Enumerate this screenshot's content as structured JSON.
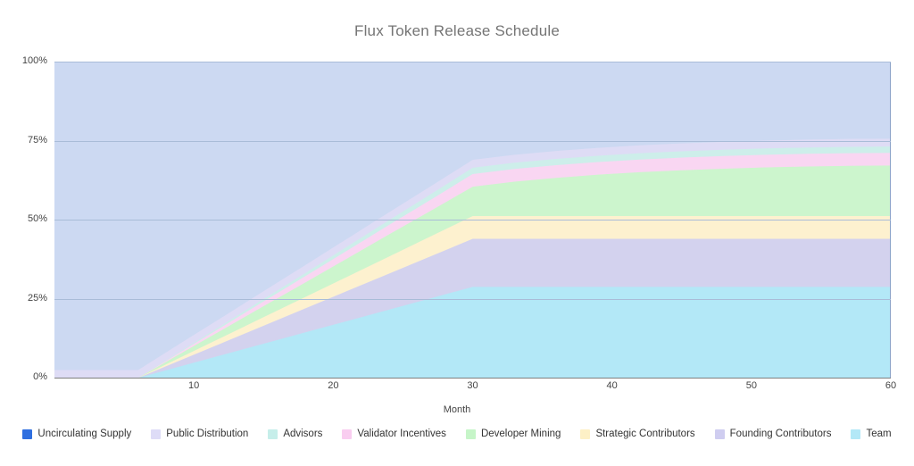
{
  "chart_data": {
    "type": "area",
    "title": "Flux Token Release Schedule",
    "xlabel": "Month",
    "ylabel": "",
    "stacked": true,
    "normalized_percent": true,
    "grid": true,
    "legend_position": "bottom",
    "xlim": [
      0,
      60
    ],
    "ylim": [
      0,
      100
    ],
    "xticks": [
      10,
      20,
      30,
      40,
      50,
      60
    ],
    "xtick_labels": [
      "10",
      "20",
      "30",
      "40",
      "50",
      "60"
    ],
    "yticks": [
      0,
      25,
      50,
      75,
      100
    ],
    "ytick_labels": [
      "0%",
      "25%",
      "50%",
      "75%",
      "100%"
    ],
    "x": [
      0,
      3,
      6,
      9,
      12,
      15,
      18,
      21,
      24,
      27,
      30,
      33,
      36,
      39,
      42,
      45,
      48,
      51,
      54,
      57,
      60
    ],
    "series": [
      {
        "name": "Team",
        "color": "#b3e8f7",
        "legend_color": "#b3e8f7",
        "values": [
          0,
          0,
          0,
          3.6,
          7.2,
          10.8,
          14.4,
          18.0,
          21.6,
          25.2,
          28.8,
          28.8,
          28.8,
          28.8,
          28.8,
          28.8,
          28.8,
          28.8,
          28.8,
          28.8,
          28.8
        ]
      },
      {
        "name": "Founding Contributors",
        "color": "#d3d2ee",
        "legend_color": "#cfcdf0",
        "values": [
          0,
          0,
          0,
          1.9,
          3.8,
          5.7,
          7.6,
          9.5,
          11.4,
          13.3,
          15.2,
          15.2,
          15.2,
          15.2,
          15.2,
          15.2,
          15.2,
          15.2,
          15.2,
          15.2,
          15.2
        ]
      },
      {
        "name": "Strategic Contributors",
        "color": "#fdf1cf",
        "legend_color": "#fdf0c6",
        "values": [
          0,
          0,
          0,
          0.9,
          1.8,
          2.7,
          3.6,
          4.5,
          5.4,
          6.3,
          7.2,
          7.2,
          7.2,
          7.2,
          7.2,
          7.2,
          7.2,
          7.2,
          7.2,
          7.2,
          7.2
        ]
      },
      {
        "name": "Developer Mining",
        "color": "#ccf5cd",
        "legend_color": "#c6f5c8",
        "values": [
          0,
          0,
          0,
          1.2,
          2.3,
          3.5,
          4.6,
          5.8,
          7.0,
          8.1,
          9.3,
          10.9,
          12.1,
          13.1,
          13.9,
          14.5,
          15.0,
          15.4,
          15.7,
          15.9,
          16.0
        ]
      },
      {
        "name": "Validator Incentives",
        "color": "#f9d6f2",
        "legend_color": "#f9cdf0",
        "values": [
          0,
          0,
          0,
          0.5,
          1.0,
          1.5,
          2.0,
          2.5,
          3.0,
          3.5,
          4.0,
          4.0,
          4.0,
          4.0,
          4.0,
          4.0,
          4.0,
          4.0,
          4.0,
          4.0,
          4.0
        ]
      },
      {
        "name": "Advisors",
        "color": "#cdeeea",
        "legend_color": "#c6eeea",
        "values": [
          0,
          0,
          0,
          0.25,
          0.5,
          0.75,
          1.0,
          1.25,
          1.5,
          1.75,
          2.0,
          2.0,
          2.0,
          2.0,
          2.0,
          2.0,
          2.0,
          2.0,
          2.0,
          2.0,
          2.0
        ]
      },
      {
        "name": "Public Distribution",
        "color": "#dedcf5",
        "legend_color": "#dedcf7",
        "values": [
          2.5,
          2.5,
          2.5,
          2.5,
          2.5,
          2.5,
          2.5,
          2.5,
          2.5,
          2.5,
          2.5,
          2.5,
          2.5,
          2.5,
          2.5,
          2.5,
          2.5,
          2.5,
          2.5,
          2.5,
          2.5
        ]
      },
      {
        "name": "Uncirculating Supply",
        "color": "#ccd9f2",
        "legend_color": "#2f6fe0",
        "values": [
          97.5,
          97.5,
          97.5,
          89.15,
          80.9,
          72.55,
          64.3,
          55.95,
          47.6,
          39.35,
          31.0,
          29.4,
          28.2,
          27.2,
          26.4,
          25.8,
          25.3,
          24.9,
          24.6,
          24.4,
          24.3
        ]
      }
    ],
    "legend_order": [
      "Uncirculating Supply",
      "Public Distribution",
      "Advisors",
      "Validator Incentives",
      "Developer Mining",
      "Strategic Contributors",
      "Founding Contributors",
      "Team"
    ]
  },
  "colors": {
    "title": "#757575",
    "gridline": "#a9bcd8",
    "plot_border": "#8aa2c8",
    "axis": "#7f7f7f",
    "background": "#ffffff"
  }
}
